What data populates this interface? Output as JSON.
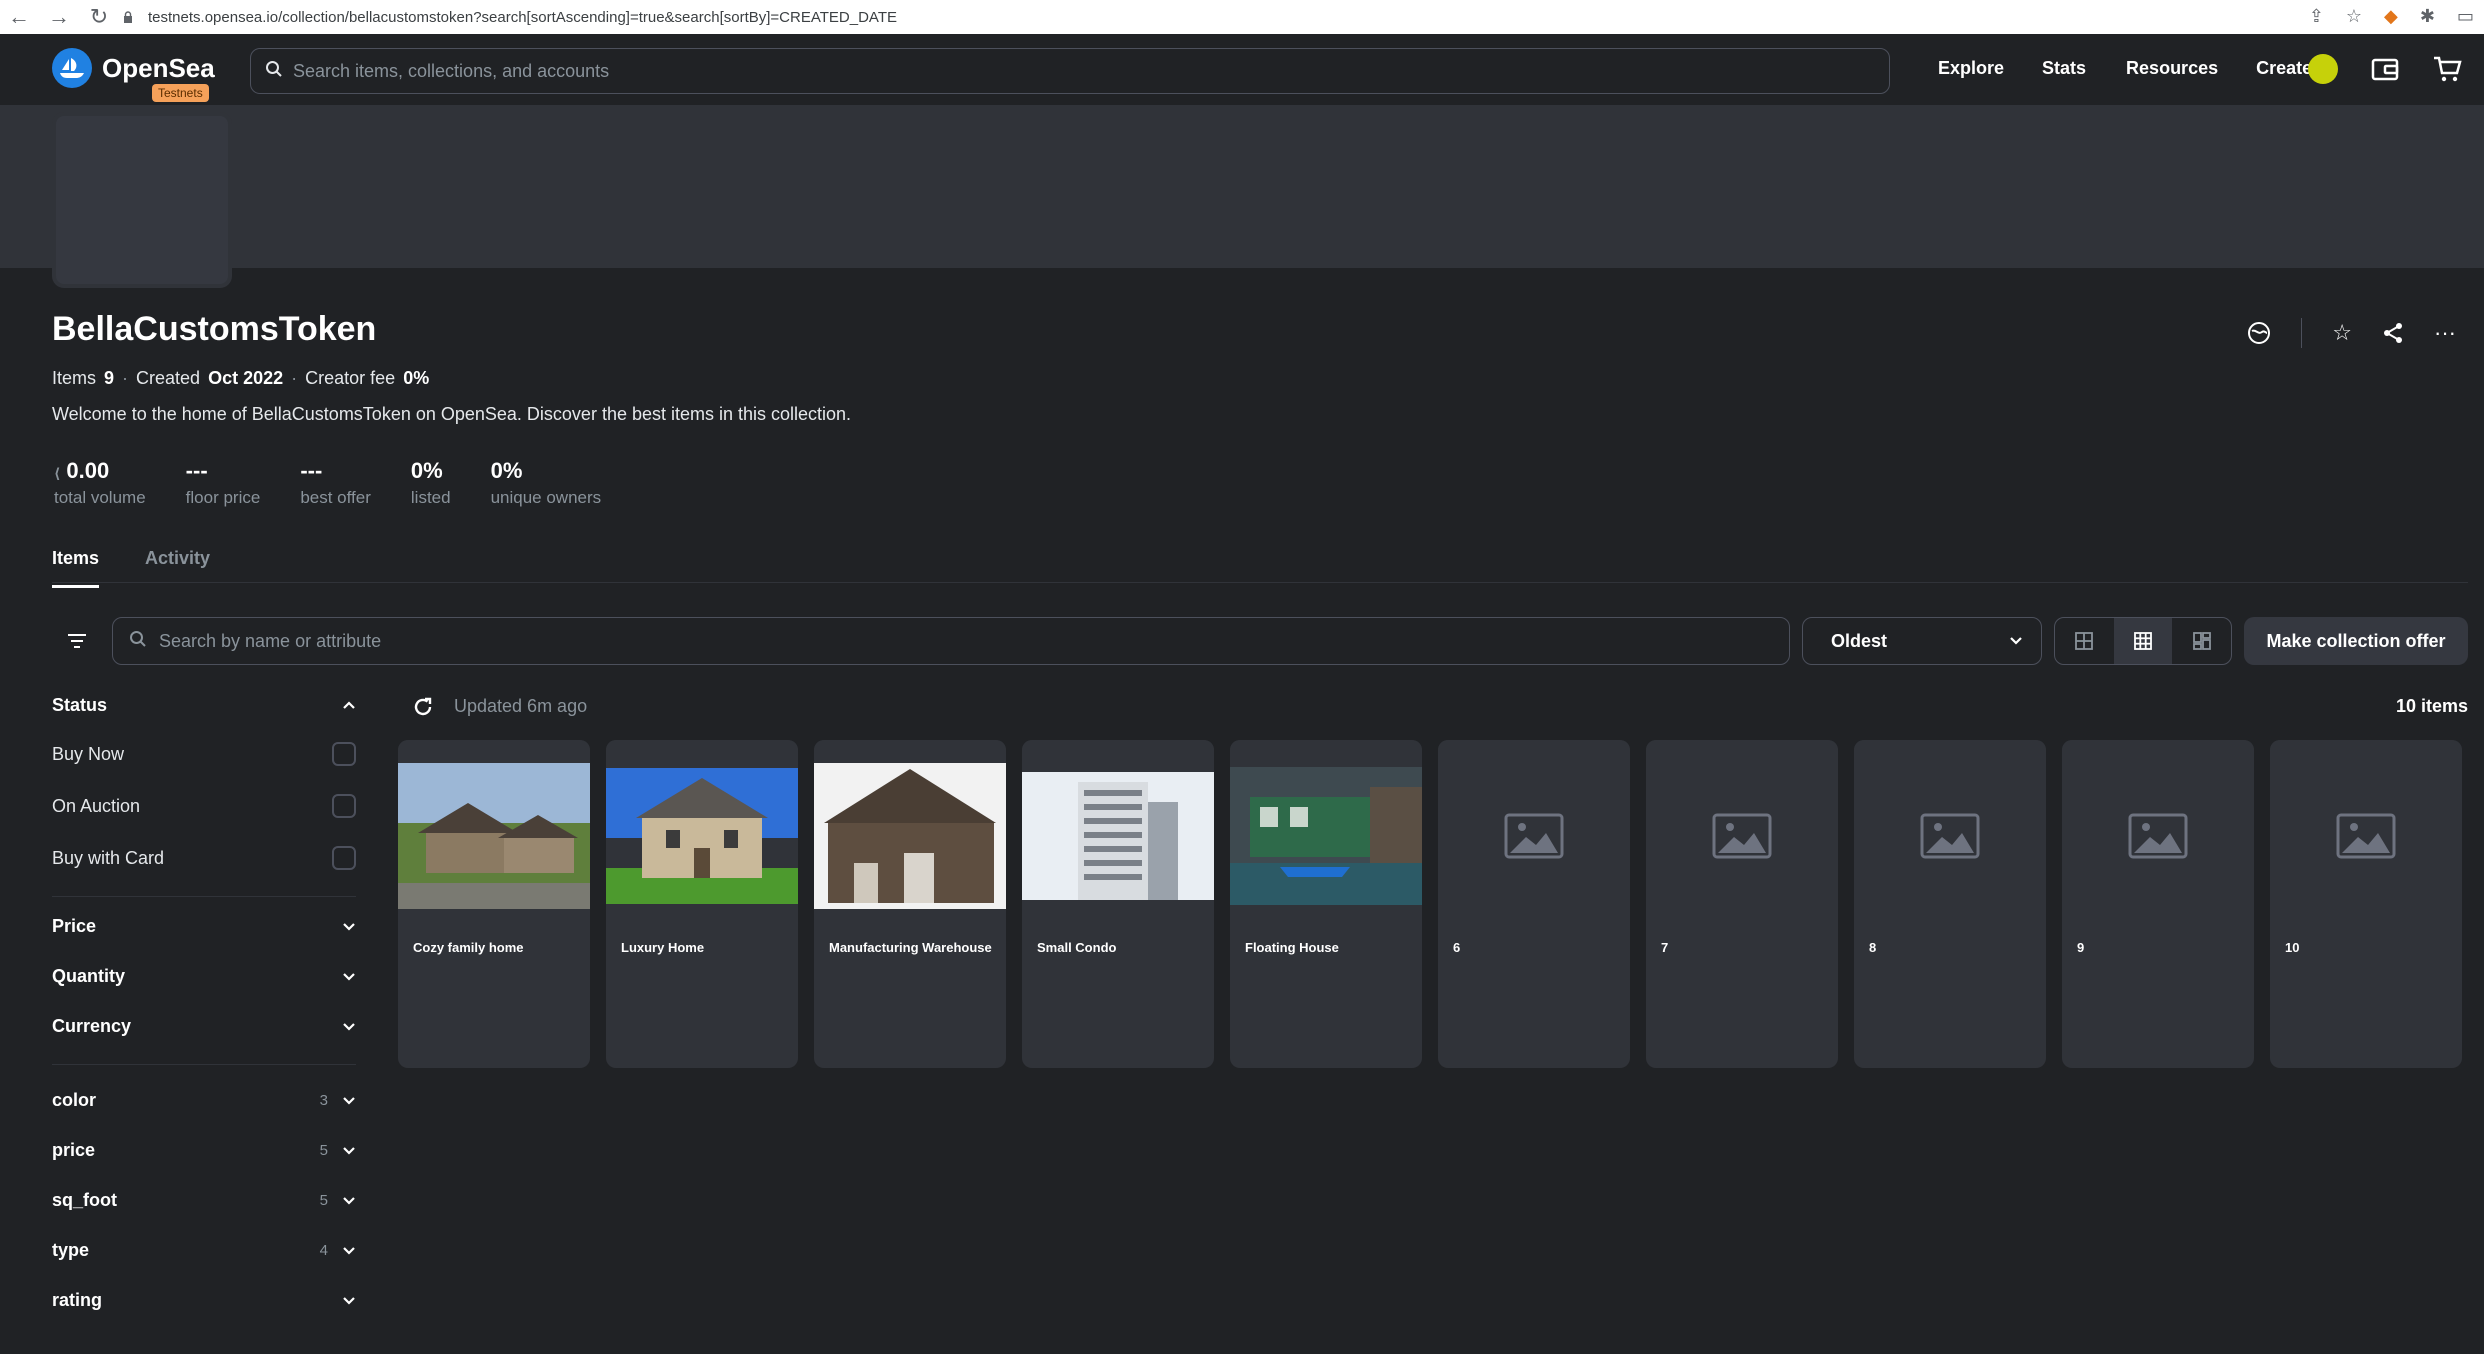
{
  "browser": {
    "url": "testnets.opensea.io/collection/bellacustomstoken?search[sortAscending]=true&search[sortBy]=CREATED_DATE"
  },
  "header": {
    "brand": "OpenSea",
    "badge": "Testnets",
    "search_placeholder": "Search items, collections, and accounts",
    "menu": [
      "Explore",
      "Stats",
      "Resources",
      "Create"
    ]
  },
  "collection": {
    "name": "BellaCustomsToken",
    "items_label": "Items",
    "items_value": "9",
    "created_label": "Created",
    "created_value": "Oct 2022",
    "fee_label": "Creator fee",
    "fee_value": "0%",
    "description": "Welcome to the home of BellaCustomsToken on OpenSea. Discover the best items in this collection.",
    "stats": [
      {
        "value": "0.00",
        "label": "total volume",
        "eth": true
      },
      {
        "value": "---",
        "label": "floor price"
      },
      {
        "value": "---",
        "label": "best offer"
      },
      {
        "value": "0%",
        "label": "listed"
      },
      {
        "value": "0%",
        "label": "unique owners"
      }
    ]
  },
  "tabs": [
    "Items",
    "Activity"
  ],
  "toolbar": {
    "search_placeholder": "Search by name or attribute",
    "sort_value": "Oldest",
    "offer_button": "Make collection offer"
  },
  "sidebar": {
    "status_title": "Status",
    "status_options": [
      "Buy Now",
      "On Auction",
      "Buy with Card"
    ],
    "filters": [
      "Price",
      "Quantity",
      "Currency"
    ],
    "traits": [
      {
        "name": "color",
        "count": "3"
      },
      {
        "name": "price",
        "count": "5"
      },
      {
        "name": "sq_foot",
        "count": "5"
      },
      {
        "name": "type",
        "count": "4"
      },
      {
        "name": "rating",
        "count": ""
      }
    ]
  },
  "results": {
    "updated": "Updated 6m ago",
    "count": "10 items"
  },
  "items": [
    {
      "name": "Cozy family home",
      "image": "house"
    },
    {
      "name": "Luxury Home",
      "image": "luxury"
    },
    {
      "name": "Manufacturing Warehouse",
      "image": "barn"
    },
    {
      "name": "Small Condo",
      "image": "condo"
    },
    {
      "name": "Floating House",
      "image": "houseboat"
    },
    {
      "name": "6",
      "image": "placeholder"
    },
    {
      "name": "7",
      "image": "placeholder"
    },
    {
      "name": "8",
      "image": "placeholder"
    },
    {
      "name": "9",
      "image": "placeholder"
    },
    {
      "name": "10",
      "image": "placeholder"
    }
  ]
}
